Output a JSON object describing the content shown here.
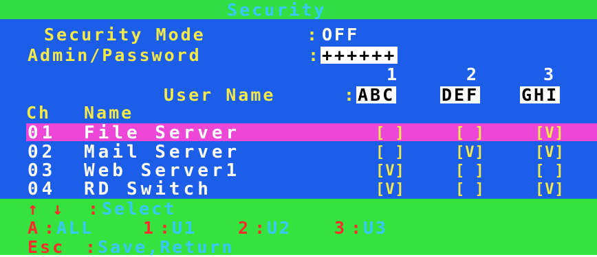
{
  "title": "Security",
  "security_mode": {
    "label": "Security Mode",
    "value": "OFF"
  },
  "admin_password": {
    "label": "Admin/Password",
    "value": "++++++"
  },
  "user_columns": [
    "1",
    "2",
    "3"
  ],
  "user_name": {
    "label": "User Name",
    "values": [
      "ABC",
      "DEF",
      "GHI"
    ]
  },
  "table_headers": {
    "ch": "Ch",
    "name": "Name"
  },
  "channels": [
    {
      "ch": "01",
      "name": "File Server",
      "checks": [
        "[ ]",
        "[ ]",
        "[V]"
      ],
      "selected": true
    },
    {
      "ch": "02",
      "name": "Mail Server",
      "checks": [
        "[ ]",
        "[V]",
        "[V]"
      ],
      "selected": false
    },
    {
      "ch": "03",
      "name": "Web Server1",
      "checks": [
        "[V]",
        "[ ]",
        "[ ]"
      ],
      "selected": false
    },
    {
      "ch": "04",
      "name": "RD Switch",
      "checks": [
        "[V]",
        "[ ]",
        "[V]"
      ],
      "selected": false
    }
  ],
  "footer": {
    "line1": {
      "key": "↑ ↓",
      "action": "Select"
    },
    "line2": [
      {
        "key": "A",
        "action": "ALL"
      },
      {
        "key": "1",
        "action": "U1"
      },
      {
        "key": "2",
        "action": "U2"
      },
      {
        "key": "3",
        "action": "U3"
      }
    ],
    "line3": {
      "key": "Esc",
      "action": "Save,Return"
    }
  },
  "colors": {
    "title_bar": "#33dd44",
    "panel": "#1d5ee8",
    "selected_row": "#ec47d6",
    "label_text": "#f4e94a",
    "value_text": "#ffffff",
    "footer_key": "#ff2a2a",
    "footer_action": "#36c8ff"
  }
}
